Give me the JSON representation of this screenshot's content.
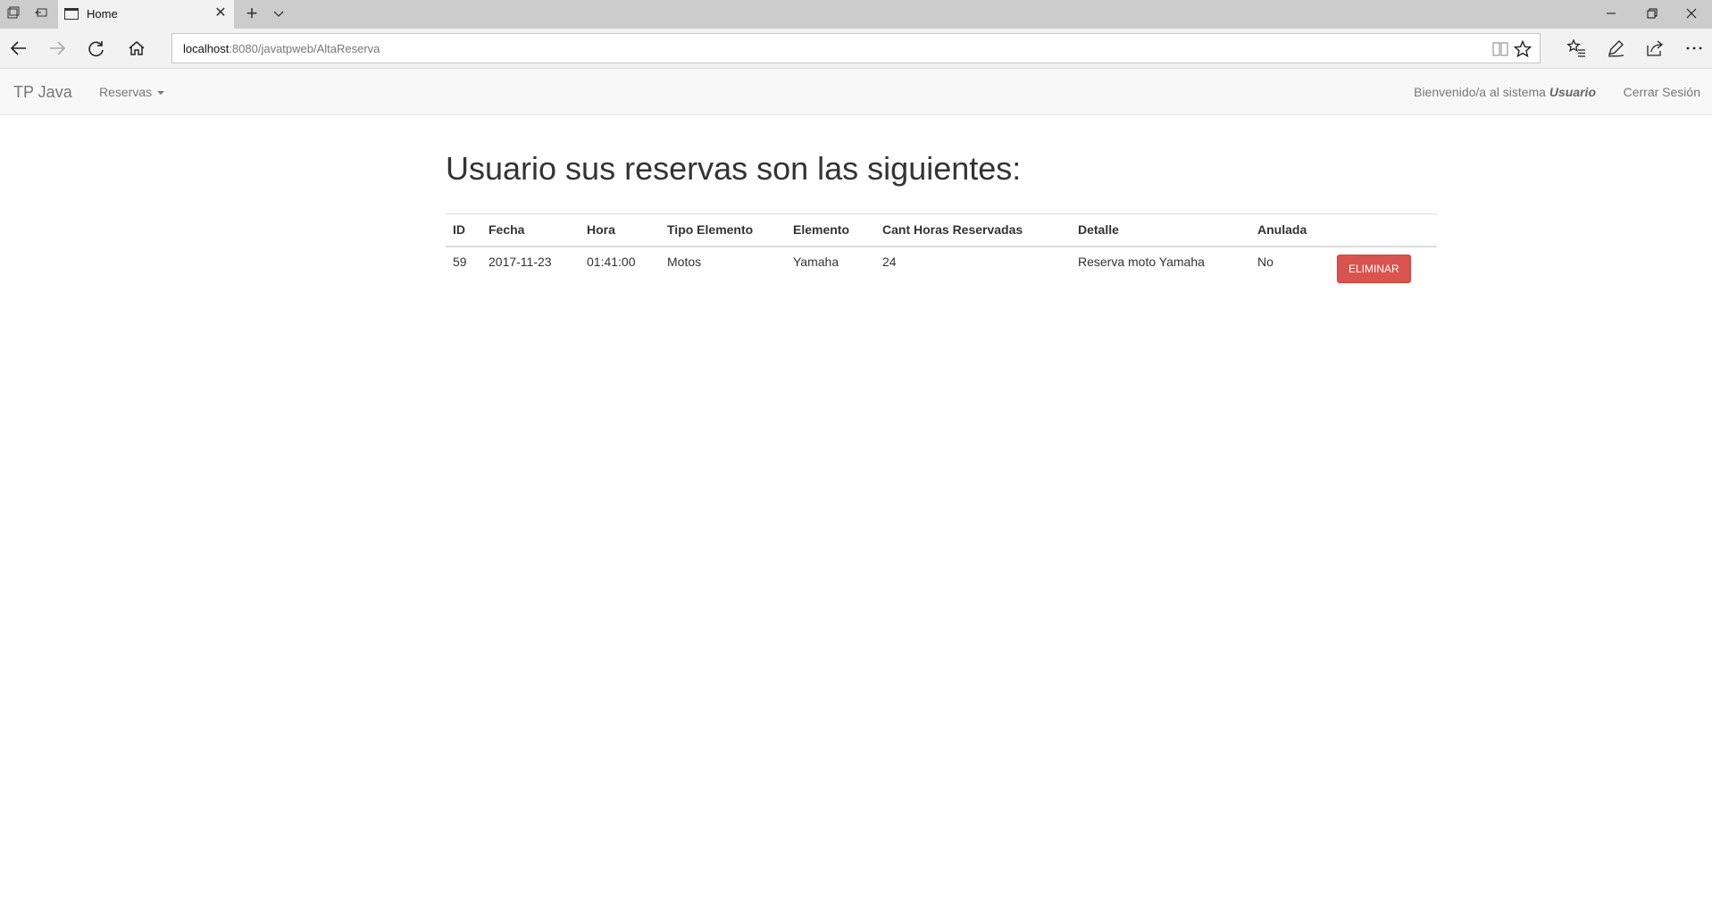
{
  "browser": {
    "tab_title": "Home",
    "url_host": "localhost",
    "url_rest": ":8080/javatpweb/AltaReserva"
  },
  "navbar": {
    "brand": "TP Java",
    "menu_label": "Reservas",
    "welcome_text": "Bienvenido/a al sistema",
    "user_name": "Usuario",
    "logout_label": "Cerrar Sesión"
  },
  "main": {
    "heading": "Usuario sus reservas son las siguientes:",
    "table": {
      "headers": [
        "ID",
        "Fecha",
        "Hora",
        "Tipo Elemento",
        "Elemento",
        "Cant Horas Reservadas",
        "Detalle",
        "Anulada"
      ],
      "rows": [
        {
          "id": "59",
          "fecha": "2017-11-23",
          "hora": "01:41:00",
          "tipo_elemento": "Motos",
          "elemento": "Yamaha",
          "cant_horas": "24",
          "detalle": "Reserva moto Yamaha",
          "anulada": "No",
          "action_label": "ELIMINAR"
        }
      ]
    }
  },
  "colors": {
    "danger": "#d9534f",
    "navbar_bg": "#f8f8f8",
    "chrome_bg": "#cccccc"
  }
}
